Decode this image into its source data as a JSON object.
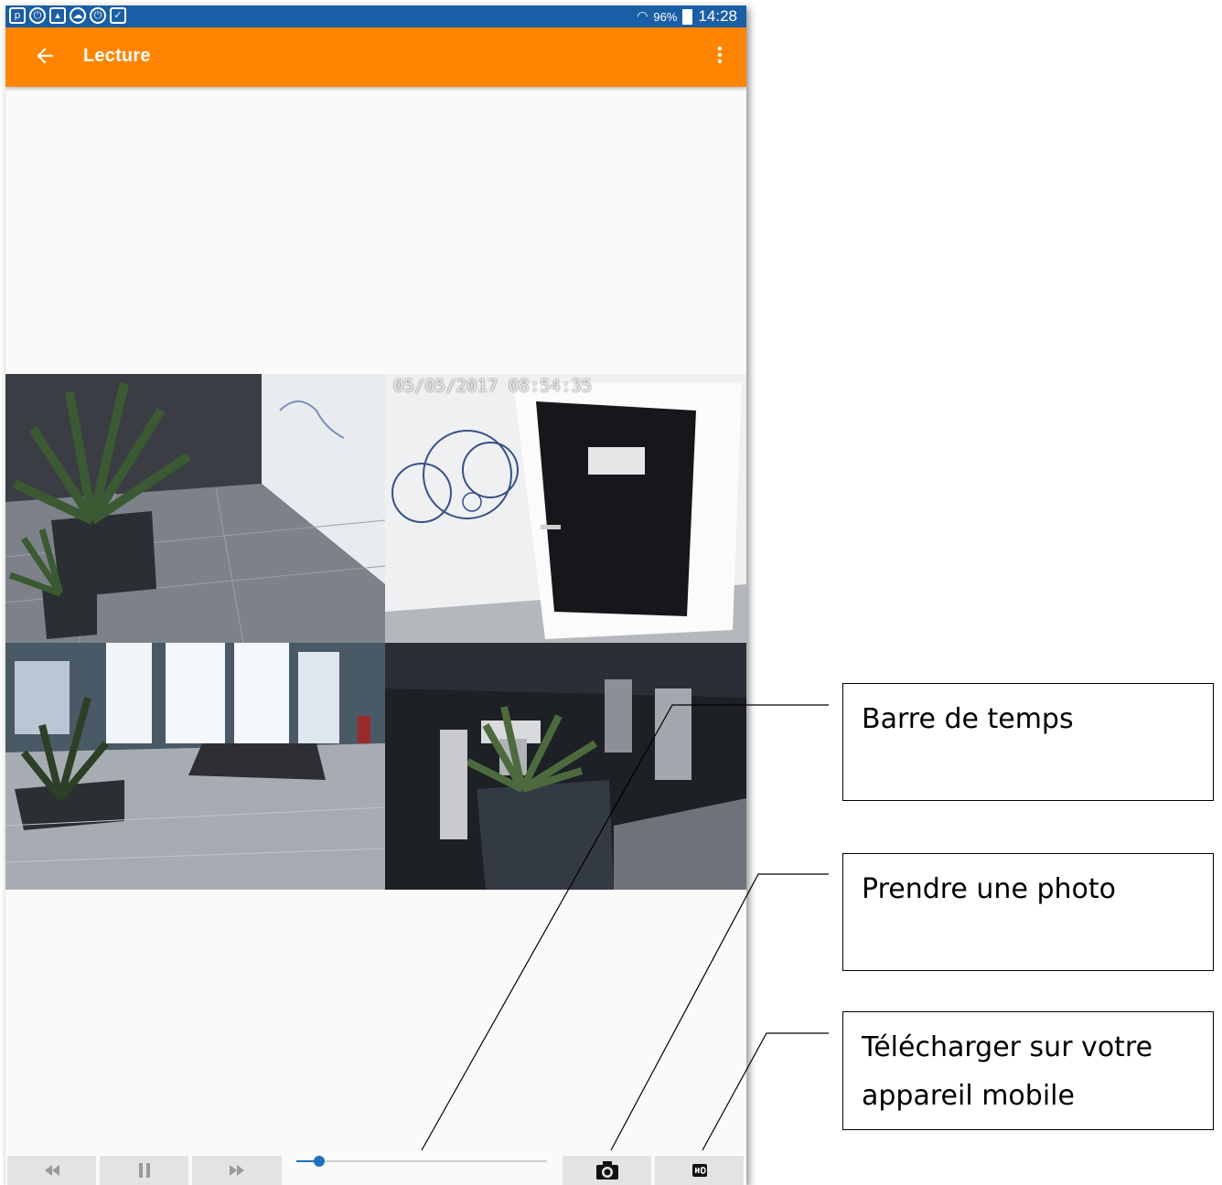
{
  "status_bar": {
    "battery_percent": "96%",
    "time": "14:28",
    "notification_icons": [
      "p-icon",
      "power-icon",
      "image-icon",
      "cloud-icon",
      "power-icon",
      "clipboard-icon"
    ]
  },
  "app_bar": {
    "title": "Lecture"
  },
  "video": {
    "timestamp": "05/05/2017 08:54:35",
    "cameras": [
      "camera-1",
      "camera-2",
      "camera-3",
      "camera-4"
    ]
  },
  "controls": {
    "timeline_position": 0.09
  },
  "callouts": {
    "timeline": "Barre de temps",
    "photo": "Prendre une photo",
    "download": "Télécharger sur votre appareil mobile"
  },
  "colors": {
    "status_bar": "#1a5fa6",
    "app_bar": "#ff8500",
    "slider": "#1f70c1"
  }
}
